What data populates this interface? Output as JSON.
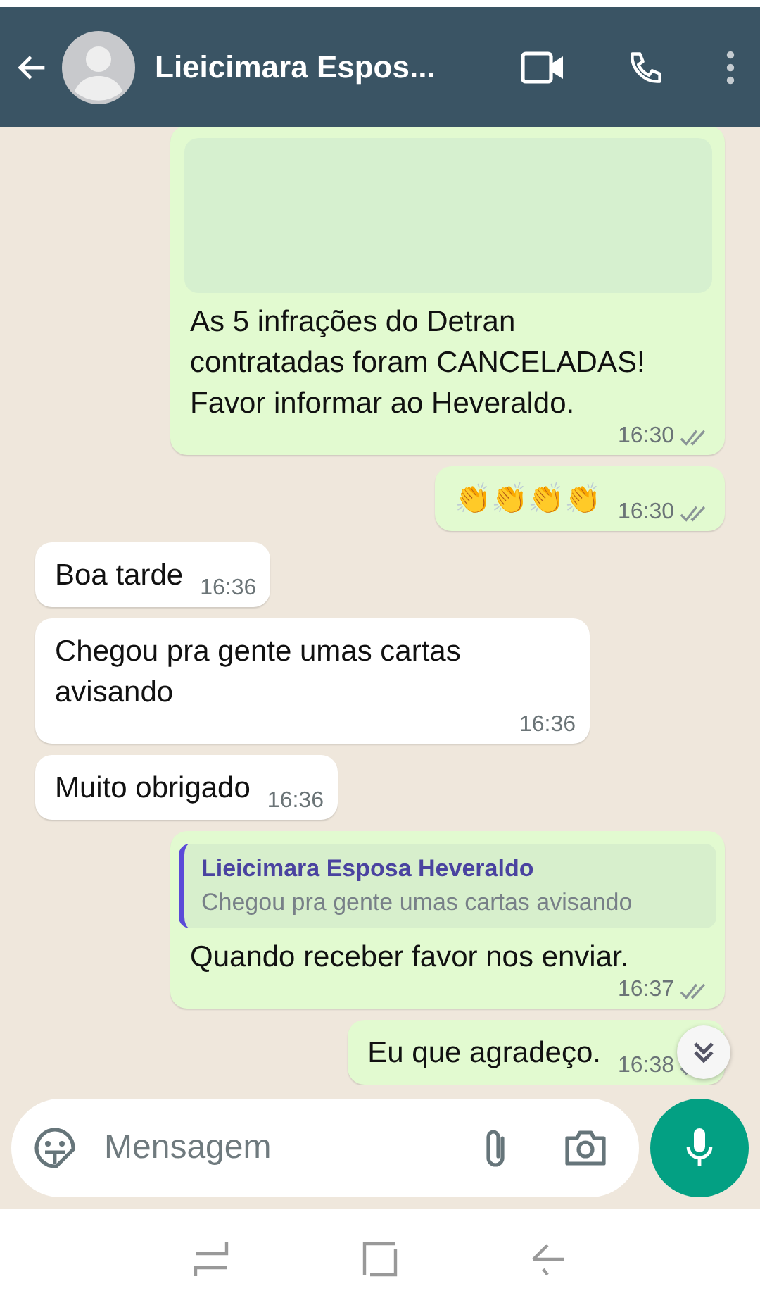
{
  "header": {
    "title": "Lieicimara Espos..."
  },
  "messages": [
    {
      "kind": "text",
      "outgoing": true,
      "preview": true,
      "text": "As 5 infrações do Detran contratadas foram CANCELADAS! Favor informar ao Heveraldo.",
      "time": "16:30",
      "read": false
    },
    {
      "kind": "text",
      "outgoing": true,
      "text": "👏👏👏👏",
      "time": "16:30",
      "read": false
    },
    {
      "kind": "text",
      "outgoing": false,
      "text": "Boa tarde",
      "time": "16:36"
    },
    {
      "kind": "text",
      "outgoing": false,
      "text": "Chegou pra gente umas cartas avisando",
      "time": "16:36"
    },
    {
      "kind": "text",
      "outgoing": false,
      "text": "Muito obrigado",
      "time": "16:36"
    },
    {
      "kind": "reply",
      "outgoing": true,
      "quote": {
        "author": "Lieicimara Esposa Heveraldo",
        "text": "Chegou pra gente umas cartas avisando"
      },
      "text": "Quando receber favor nos enviar.",
      "time": "16:37",
      "read": false
    },
    {
      "kind": "text",
      "outgoing": true,
      "text": "Eu que agradeço.",
      "time": "16:38",
      "read": false
    }
  ],
  "composer": {
    "placeholder": "Mensagem"
  }
}
